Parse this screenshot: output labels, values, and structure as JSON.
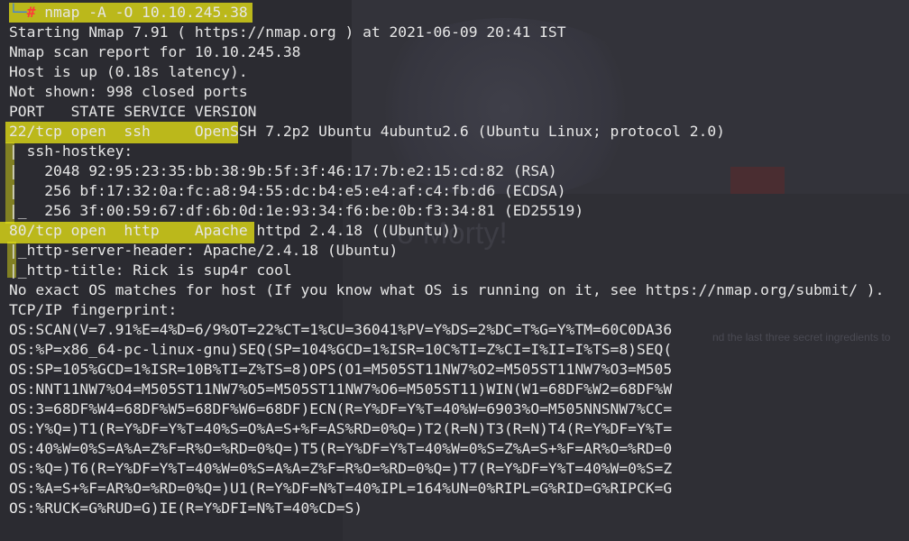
{
  "background": {
    "title": "o Morty!",
    "sub": "nd the last three secret ingredients to"
  },
  "prompt": {
    "prefix": "└─",
    "symbol": "#",
    "command": " nmap -A -O 10.10.245.38"
  },
  "output": [
    "Starting Nmap 7.91 ( https://nmap.org ) at 2021-06-09 20:41 IST",
    "Nmap scan report for 10.10.245.38",
    "Host is up (0.18s latency).",
    "Not shown: 998 closed ports",
    "PORT   STATE SERVICE VERSION"
  ],
  "ssh": {
    "port_line": "22/tcp open  ssh     OpenSSH 7.2p2 Ubuntu 4ubuntu2.6 (Ubuntu Linux; protocol 2.0)",
    "hostkey_label": "| ssh-hostkey:",
    "keys": [
      "|   2048 92:95:23:35:bb:38:9b:5f:3f:46:17:7b:e2:15:cd:82 (RSA)",
      "|   256 bf:17:32:0a:fc:a8:94:55:dc:b4:e5:e4:af:c4:fb:d6 (ECDSA)",
      "|_  256 3f:00:59:67:df:6b:0d:1e:93:34:f6:be:0b:f3:34:81 (ED25519)"
    ]
  },
  "http": {
    "port_line": "80/tcp open  http    Apache httpd 2.4.18 ((Ubuntu))",
    "server_header": "|_http-server-header: Apache/2.4.18 (Ubuntu)",
    "title": "|_http-title: Rick is sup4r cool"
  },
  "os": {
    "no_match": "No exact OS matches for host (If you know what OS is running on it, see https://nmap.org/submit/ ).",
    "fingerprint_label": "TCP/IP fingerprint:",
    "lines": [
      "OS:SCAN(V=7.91%E=4%D=6/9%OT=22%CT=1%CU=36041%PV=Y%DS=2%DC=T%G=Y%TM=60C0DA36",
      "OS:%P=x86_64-pc-linux-gnu)SEQ(SP=104%GCD=1%ISR=10C%TI=Z%CI=I%II=I%TS=8)SEQ(",
      "OS:SP=105%GCD=1%ISR=10B%TI=Z%TS=8)OPS(O1=M505ST11NW7%O2=M505ST11NW7%O3=M505",
      "OS:NNT11NW7%O4=M505ST11NW7%O5=M505ST11NW7%O6=M505ST11)WIN(W1=68DF%W2=68DF%W",
      "OS:3=68DF%W4=68DF%W5=68DF%W6=68DF)ECN(R=Y%DF=Y%T=40%W=6903%O=M505NNSNW7%CC=",
      "OS:Y%Q=)T1(R=Y%DF=Y%T=40%S=O%A=S+%F=AS%RD=0%Q=)T2(R=N)T3(R=N)T4(R=Y%DF=Y%T=",
      "OS:40%W=0%S=A%A=Z%F=R%O=%RD=0%Q=)T5(R=Y%DF=Y%T=40%W=0%S=Z%A=S+%F=AR%O=%RD=0",
      "OS:%Q=)T6(R=Y%DF=Y%T=40%W=0%S=A%A=Z%F=R%O=%RD=0%Q=)T7(R=Y%DF=Y%T=40%W=0%S=Z",
      "OS:%A=S+%F=AR%O=%RD=0%Q=)U1(R=Y%DF=N%T=40%IPL=164%UN=0%RIPL=G%RID=G%RIPCK=G",
      "OS:%RUCK=G%RUD=G)IE(R=Y%DFI=N%T=40%CD=S)"
    ]
  },
  "colors": {
    "background": "#2b2b31",
    "text": "#e6e6e6",
    "highlight": "#f2ef1f",
    "prompt_hash": "#ff3b3b",
    "prompt_bracket": "#3d7fe0"
  }
}
